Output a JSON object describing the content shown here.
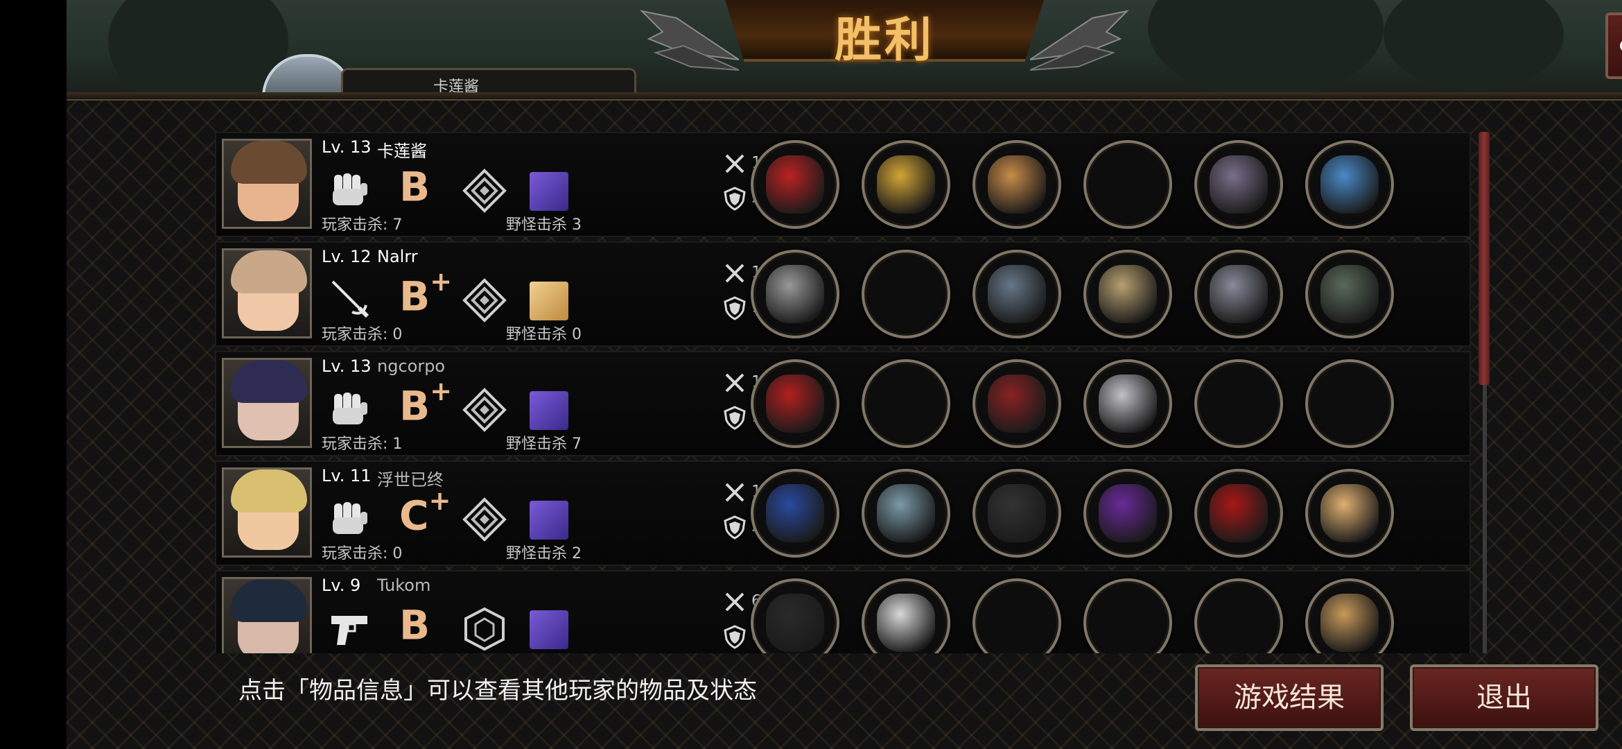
{
  "header": {
    "title": "胜利",
    "share_icon": "share-icon",
    "profile_name": "卡莲酱"
  },
  "labels": {
    "player_kills": "玩家击杀:",
    "monster_kills": "野怪击杀"
  },
  "players": [
    {
      "level": "Lv. 13",
      "name": "卡莲酱",
      "weapon_icon": "fist-icon",
      "grade": "B",
      "grade_plus": "",
      "rank_icon": "rank-diamond-icon",
      "player_kills": "7",
      "monster_kills": "3",
      "attack": "127",
      "defense": "204",
      "items": [
        "gauntlet-icon",
        "crown-icon",
        "grapes-arm-icon",
        "",
        "boots-icon",
        "bracelet-icon"
      ]
    },
    {
      "level": "Lv. 12",
      "name": "Nalrr",
      "weapon_icon": "rapier-icon",
      "grade": "B",
      "grade_plus": "+",
      "rank_icon": "rank-diamond-icon",
      "player_kills": "0",
      "monster_kills": "0",
      "attack": "122",
      "defense": "111",
      "items": [
        "spear-icon",
        "",
        "chainmail-icon",
        "watch-icon",
        "chain-sleeves-icon",
        "suspenders-icon"
      ]
    },
    {
      "level": "Lv. 13",
      "name": "ngcorpo",
      "weapon_icon": "fist-icon",
      "grade": "B",
      "grade_plus": "+",
      "rank_icon": "rank-diamond-icon",
      "player_kills": "1",
      "monster_kills": "7",
      "attack": "143",
      "defense": "128",
      "items": [
        "winged-bracer-icon",
        "",
        "armor-cape-icon",
        "blade-icon",
        "",
        ""
      ]
    },
    {
      "level": "Lv. 11",
      "name": "浮世已终",
      "weapon_icon": "fist-icon",
      "grade": "C",
      "grade_plus": "+",
      "rank_icon": "rank-diamond-icon",
      "player_kills": "0",
      "monster_kills": "2",
      "attack": "114",
      "defense": "217",
      "items": [
        "blue-gauntlet-icon",
        "knight-helmet-icon",
        "tuxedo-icon",
        "purple-glove-icon",
        "red-heels-icon",
        "portrait-fan-icon"
      ]
    },
    {
      "level": "Lv. 9",
      "name": "Tukom",
      "weapon_icon": "pistol-icon",
      "grade": "B",
      "grade_plus": "",
      "rank_icon": "rank-hex-icon",
      "player_kills": "",
      "monster_kills": "",
      "attack": "68",
      "defense": "63",
      "items": [
        "smg-icon",
        "moto-helmet-icon",
        "",
        "",
        "",
        "box-icon"
      ]
    }
  ],
  "footer": {
    "tip": "点击「物品信息」可以查看其他玩家的物品及状态",
    "result_button": "游戏结果",
    "exit_button": "退出"
  },
  "colors": {
    "title_gold": "#f3c06a",
    "button_red": "#6a2622",
    "grade_peach": "#e9b98d"
  }
}
